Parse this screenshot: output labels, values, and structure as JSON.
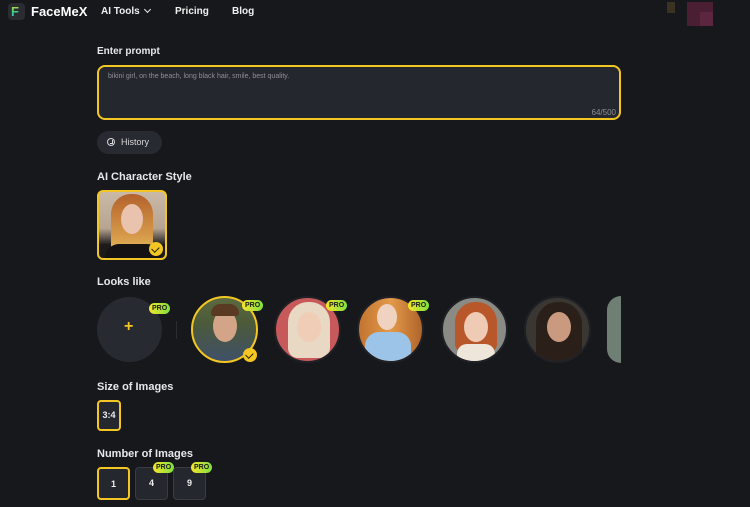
{
  "nav": {
    "brand": "FaceMeX",
    "logo_icon": "facemex-logo-icon",
    "links": [
      {
        "label": "AI Tools",
        "has_dropdown": true
      },
      {
        "label": "Pricing"
      },
      {
        "label": "Blog"
      }
    ]
  },
  "prompt": {
    "label": "Enter prompt",
    "value": "bikini girl, on the beach, long black hair, smile, best quality.",
    "counter": "64/500"
  },
  "history": {
    "label": "History",
    "icon": "clock-icon"
  },
  "character_style": {
    "label": "AI Character Style",
    "items": [
      {
        "name": "redhead-woman-style",
        "selected": true
      }
    ]
  },
  "looks_like": {
    "label": "Looks like",
    "add": {
      "symbol": "+",
      "badge": "PRO"
    },
    "items": [
      {
        "name": "man-dark-hair-denim-shirt",
        "badge": "PRO",
        "selected": true
      },
      {
        "name": "blonde-woman-red-background",
        "badge": "PRO",
        "selected": false
      },
      {
        "name": "woman-blue-dress-trophy",
        "badge": "PRO",
        "selected": false
      },
      {
        "name": "redhead-woman-sweater",
        "badge": "",
        "selected": false
      },
      {
        "name": "brunette-woman",
        "badge": "",
        "selected": false
      },
      {
        "name": "partial-portrait",
        "badge": "",
        "selected": false
      }
    ]
  },
  "size": {
    "label": "Size of Images",
    "options": [
      {
        "label": "3:4",
        "selected": true
      }
    ]
  },
  "number": {
    "label": "Number of Images",
    "options": [
      {
        "label": "1",
        "badge": "",
        "selected": true
      },
      {
        "label": "4",
        "badge": "PRO",
        "selected": false
      },
      {
        "label": "9",
        "badge": "PRO",
        "selected": false
      }
    ]
  },
  "colors": {
    "accent": "#f3c623",
    "background": "#17181c",
    "surface": "#25272e",
    "pro_badge_from": "#f5e52a",
    "pro_badge_to": "#7fe040"
  }
}
